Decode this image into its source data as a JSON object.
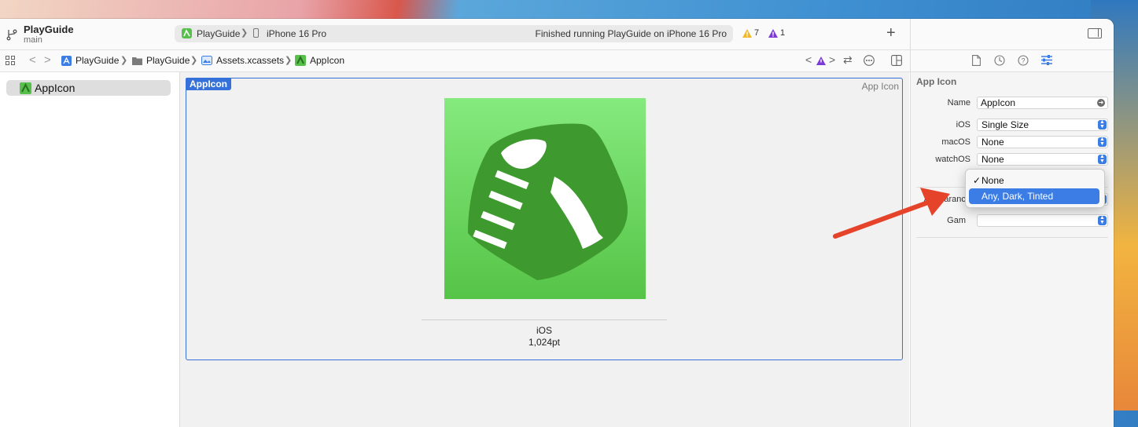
{
  "toolbar": {
    "project": "PlayGuide",
    "branch": "main",
    "scheme": "PlayGuide",
    "device": "iPhone 16 Pro",
    "status": "Finished running PlayGuide on iPhone 16 Pro",
    "warnings_count": "7",
    "issues_count": "1"
  },
  "jumpbar": {
    "crumbs": [
      "PlayGuide",
      "PlayGuide",
      "Assets.xcassets",
      "AppIcon"
    ]
  },
  "sidebar": {
    "items": [
      {
        "label": "AppIcon"
      }
    ]
  },
  "canvas": {
    "set_name": "AppIcon",
    "set_type": "App Icon",
    "platform": "iOS",
    "size": "1,024pt"
  },
  "inspector": {
    "title": "App Icon",
    "name_label": "Name",
    "name_value": "AppIcon",
    "ios_label": "iOS",
    "ios_value": "Single Size",
    "macos_label": "macOS",
    "macos_value": "None",
    "watchos_label": "watchOS",
    "watchos_value": "None",
    "appearance_label": "Appearance",
    "gamut_label": "Gam"
  },
  "menu": {
    "options": [
      {
        "label": "None",
        "checked": true
      },
      {
        "label": "Any, Dark, Tinted",
        "highlighted": true
      }
    ]
  },
  "colors": {
    "accent": "#3b7ce5",
    "selection_border": "#3671d9",
    "icon_green_light": "#7ee57a",
    "icon_green_dark": "#3e9a2e",
    "annotation_arrow": "#e5432a"
  }
}
